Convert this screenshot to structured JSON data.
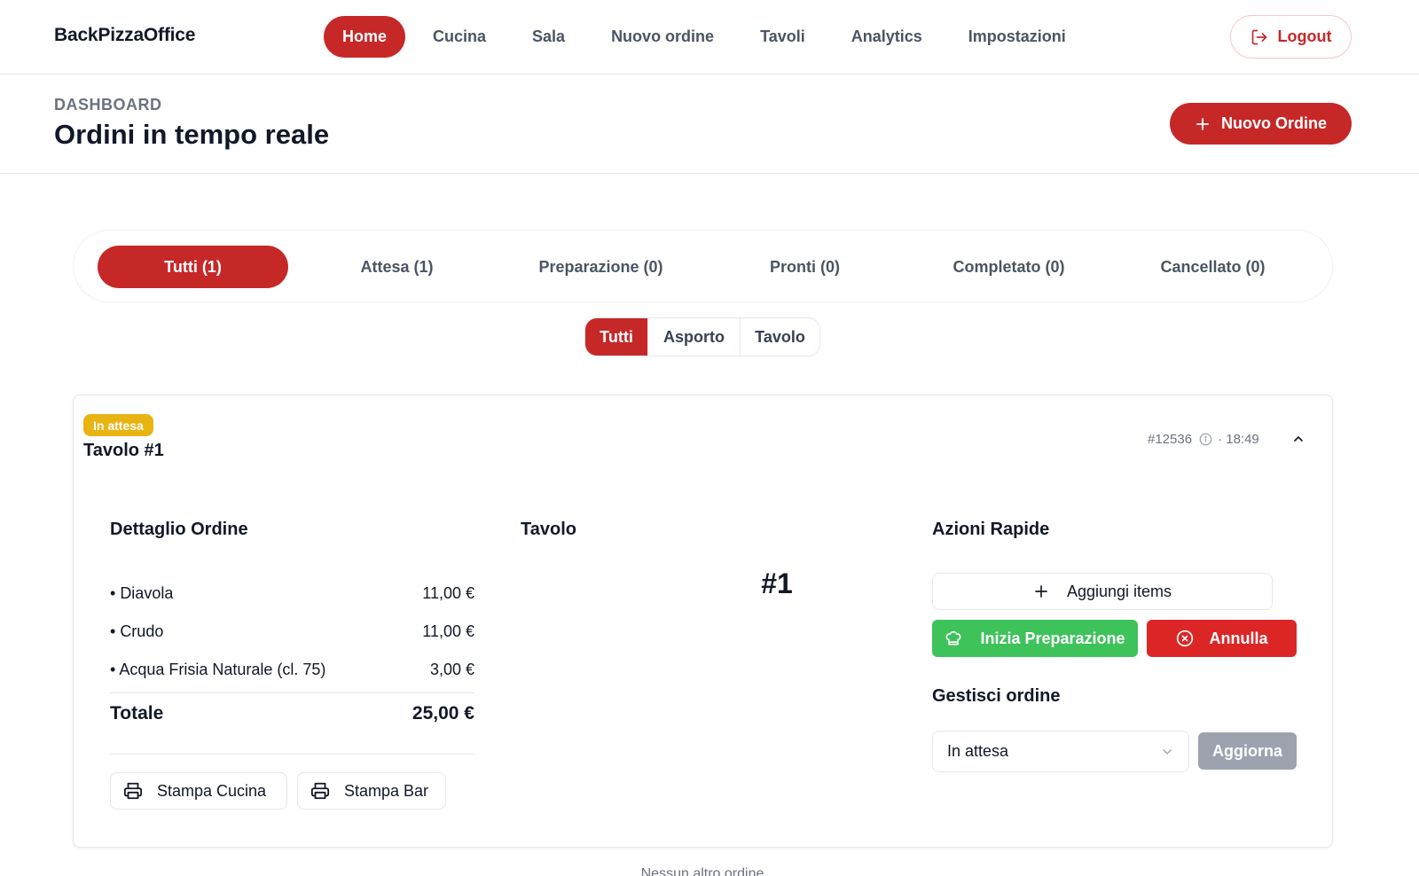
{
  "header": {
    "brand": "BackPizzaOffice",
    "nav": [
      "Home",
      "Cucina",
      "Sala",
      "Nuovo ordine",
      "Tavoli",
      "Analytics",
      "Impostazioni"
    ],
    "active_nav": "Home",
    "logout_label": "Logout",
    "accent_color": "#c62828"
  },
  "page": {
    "breadcrumb": "DASHBOARD",
    "title": "Ordini in tempo reale",
    "new_order_label": "Nuovo Ordine"
  },
  "status_tabs": [
    "Tutti (1)",
    "Attesa (1)",
    "Preparazione (0)",
    "Pronti (0)",
    "Completato (0)",
    "Cancellato (0)"
  ],
  "type_filter": [
    "Tutti",
    "Asporto",
    "Tavolo"
  ],
  "order": {
    "status": "In attesa",
    "status_color": "#e8b413",
    "title": "Tavolo #1",
    "id": "#12536",
    "time": "· 18:49",
    "detail_title": "Dettaglio Ordine",
    "items": [
      {
        "name": "Diavola",
        "price": "11,00 €"
      },
      {
        "name": "Crudo",
        "price": "11,00 €"
      },
      {
        "name": "Acqua Frisia Naturale (cl. 75)",
        "price": "3,00 €"
      }
    ],
    "total_label": "Totale",
    "total_value": "25,00 €",
    "print_kitchen": "Stampa Cucina",
    "print_bar": "Stampa Bar",
    "table_title": "Tavolo",
    "table_number": "#1",
    "quick_actions_title": "Azioni Rapide",
    "add_items_label": "Aggiungi items",
    "start_prep_label": "Inizia Preparazione",
    "cancel_label": "Annulla",
    "manage_title": "Gestisci ordine",
    "select_value": "In attesa",
    "update_label": "Aggiorna"
  },
  "empty_note": "Nessun altro ordine"
}
